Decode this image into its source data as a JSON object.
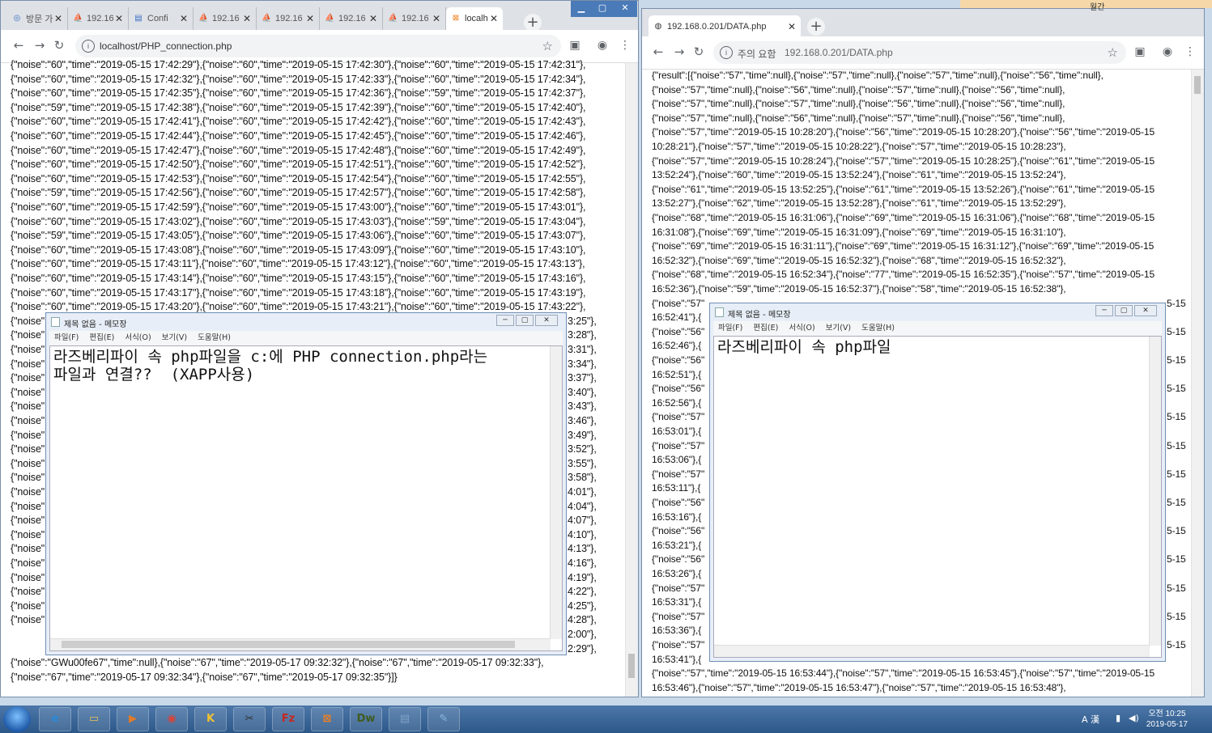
{
  "left_browser": {
    "tabs": [
      {
        "label": "방문 가",
        "icon": "compass-icon"
      },
      {
        "label": "192.16",
        "icon": "pma-icon"
      },
      {
        "label": "Confi",
        "icon": "page-icon"
      },
      {
        "label": "192.16",
        "icon": "pma-icon"
      },
      {
        "label": "192.16",
        "icon": "pma-icon"
      },
      {
        "label": "192.16",
        "icon": "pma-icon"
      },
      {
        "label": "192.16",
        "icon": "pma-icon"
      },
      {
        "label": "localh",
        "icon": "xampp-icon"
      }
    ],
    "url": "localhost/PHP_connection.php",
    "lines": [
      "{\"noise\":\"60\",\"time\":\"2019-05-15 17:42:29\"},{\"noise\":\"60\",\"time\":\"2019-05-15 17:42:30\"},{\"noise\":\"60\",\"time\":\"2019-05-15 17:42:31\"},",
      "{\"noise\":\"60\",\"time\":\"2019-05-15 17:42:32\"},{\"noise\":\"60\",\"time\":\"2019-05-15 17:42:33\"},{\"noise\":\"60\",\"time\":\"2019-05-15 17:42:34\"},",
      "{\"noise\":\"60\",\"time\":\"2019-05-15 17:42:35\"},{\"noise\":\"60\",\"time\":\"2019-05-15 17:42:36\"},{\"noise\":\"59\",\"time\":\"2019-05-15 17:42:37\"},",
      "{\"noise\":\"59\",\"time\":\"2019-05-15 17:42:38\"},{\"noise\":\"60\",\"time\":\"2019-05-15 17:42:39\"},{\"noise\":\"60\",\"time\":\"2019-05-15 17:42:40\"},",
      "{\"noise\":\"60\",\"time\":\"2019-05-15 17:42:41\"},{\"noise\":\"60\",\"time\":\"2019-05-15 17:42:42\"},{\"noise\":\"60\",\"time\":\"2019-05-15 17:42:43\"},",
      "{\"noise\":\"60\",\"time\":\"2019-05-15 17:42:44\"},{\"noise\":\"60\",\"time\":\"2019-05-15 17:42:45\"},{\"noise\":\"60\",\"time\":\"2019-05-15 17:42:46\"},",
      "{\"noise\":\"60\",\"time\":\"2019-05-15 17:42:47\"},{\"noise\":\"60\",\"time\":\"2019-05-15 17:42:48\"},{\"noise\":\"60\",\"time\":\"2019-05-15 17:42:49\"},",
      "{\"noise\":\"60\",\"time\":\"2019-05-15 17:42:50\"},{\"noise\":\"60\",\"time\":\"2019-05-15 17:42:51\"},{\"noise\":\"60\",\"time\":\"2019-05-15 17:42:52\"},",
      "{\"noise\":\"60\",\"time\":\"2019-05-15 17:42:53\"},{\"noise\":\"60\",\"time\":\"2019-05-15 17:42:54\"},{\"noise\":\"60\",\"time\":\"2019-05-15 17:42:55\"},",
      "{\"noise\":\"59\",\"time\":\"2019-05-15 17:42:56\"},{\"noise\":\"60\",\"time\":\"2019-05-15 17:42:57\"},{\"noise\":\"60\",\"time\":\"2019-05-15 17:42:58\"},",
      "{\"noise\":\"60\",\"time\":\"2019-05-15 17:42:59\"},{\"noise\":\"60\",\"time\":\"2019-05-15 17:43:00\"},{\"noise\":\"60\",\"time\":\"2019-05-15 17:43:01\"},",
      "{\"noise\":\"60\",\"time\":\"2019-05-15 17:43:02\"},{\"noise\":\"60\",\"time\":\"2019-05-15 17:43:03\"},{\"noise\":\"59\",\"time\":\"2019-05-15 17:43:04\"},",
      "{\"noise\":\"59\",\"time\":\"2019-05-15 17:43:05\"},{\"noise\":\"60\",\"time\":\"2019-05-15 17:43:06\"},{\"noise\":\"60\",\"time\":\"2019-05-15 17:43:07\"},",
      "{\"noise\":\"60\",\"time\":\"2019-05-15 17:43:08\"},{\"noise\":\"60\",\"time\":\"2019-05-15 17:43:09\"},{\"noise\":\"60\",\"time\":\"2019-05-15 17:43:10\"},",
      "{\"noise\":\"60\",\"time\":\"2019-05-15 17:43:11\"},{\"noise\":\"60\",\"time\":\"2019-05-15 17:43:12\"},{\"noise\":\"60\",\"time\":\"2019-05-15 17:43:13\"},",
      "{\"noise\":\"60\",\"time\":\"2019-05-15 17:43:14\"},{\"noise\":\"60\",\"time\":\"2019-05-15 17:43:15\"},{\"noise\":\"60\",\"time\":\"2019-05-15 17:43:16\"},",
      "{\"noise\":\"60\",\"time\":\"2019-05-15 17:43:17\"},{\"noise\":\"60\",\"time\":\"2019-05-15 17:43:18\"},{\"noise\":\"60\",\"time\":\"2019-05-15 17:43:19\"},",
      "{\"noise\":\"60\",\"time\":\"2019-05-15 17:43:20\"},{\"noise\":\"60\",\"time\":\"2019-05-15 17:43:21\"},{\"noise\":\"60\",\"time\":\"2019-05-15 17:43:22\"},"
    ],
    "partial_left": [
      "{\"noise\"",
      "{\"noise\"",
      "{\"noise\"",
      "{\"noise\"",
      "{\"noise\"",
      "{\"noise\"",
      "{\"noise\"",
      "{\"noise\"",
      "{\"noise\"",
      "{\"noise\"",
      "{\"noise\"",
      "{\"noise\"",
      "{\"noise\"",
      "{\"noise\"",
      "{\"noise\"",
      "{\"noise\"",
      "{\"noise\"",
      "{\"noise\"",
      "{\"noise\"",
      "{\"noise\"",
      "{\"noise\"",
      "{\"noise\""
    ],
    "partial_right": [
      "3:25\"},",
      "3:28\"},",
      "3:31\"},",
      "3:34\"},",
      "3:37\"},",
      "3:40\"},",
      "3:43\"},",
      "3:46\"},",
      "3:49\"},",
      "3:52\"},",
      "3:55\"},",
      "3:58\"},",
      "4:01\"},",
      "4:04\"},",
      "4:07\"},",
      "4:10\"},",
      "4:13\"},",
      "4:16\"},",
      "4:19\"},",
      "4:22\"},",
      "4:25\"},",
      "4:28\"},",
      "2:00\"},",
      "2:29\"},"
    ],
    "tail_lines": [
      "{\"noise\":\"GWu00fe67\",\"time\":null},{\"noise\":\"67\",\"time\":\"2019-05-17 09:32:32\"},{\"noise\":\"67\",\"time\":\"2019-05-17 09:32:33\"},",
      "{\"noise\":\"67\",\"time\":\"2019-05-17 09:32:34\"},{\"noise\":\"67\",\"time\":\"2019-05-17 09:32:35\"}]}"
    ]
  },
  "left_notepad": {
    "title": "제목 없음 - 메모장",
    "menu": [
      "파일(F)",
      "편집(E)",
      "서식(O)",
      "보기(V)",
      "도움말(H)"
    ],
    "text": "라즈베리파이 속 php파일을 c:에 PHP connection.php라는\n파일과 연결??  (XAPP사용)"
  },
  "right_browser": {
    "tab_label": "192.168.0.201/DATA.php",
    "security_label": "주의 요함",
    "url": "192.168.0.201/DATA.php",
    "lines": [
      "{\"result\":[{\"noise\":\"57\",\"time\":null},{\"noise\":\"57\",\"time\":null},{\"noise\":\"57\",\"time\":null},{\"noise\":\"56\",\"time\":null},",
      "{\"noise\":\"57\",\"time\":null},{\"noise\":\"56\",\"time\":null},{\"noise\":\"57\",\"time\":null},{\"noise\":\"56\",\"time\":null},",
      "{\"noise\":\"57\",\"time\":null},{\"noise\":\"57\",\"time\":null},{\"noise\":\"56\",\"time\":null},{\"noise\":\"56\",\"time\":null},",
      "{\"noise\":\"57\",\"time\":null},{\"noise\":\"56\",\"time\":null},{\"noise\":\"57\",\"time\":null},{\"noise\":\"56\",\"time\":null},",
      "{\"noise\":\"57\",\"time\":\"2019-05-15 10:28:20\"},{\"noise\":\"56\",\"time\":\"2019-05-15 10:28:20\"},{\"noise\":\"56\",\"time\":\"2019-05-15",
      "10:28:21\"},{\"noise\":\"57\",\"time\":\"2019-05-15 10:28:22\"},{\"noise\":\"57\",\"time\":\"2019-05-15 10:28:23\"},",
      "{\"noise\":\"57\",\"time\":\"2019-05-15 10:28:24\"},{\"noise\":\"57\",\"time\":\"2019-05-15 10:28:25\"},{\"noise\":\"61\",\"time\":\"2019-05-15",
      "13:52:24\"},{\"noise\":\"60\",\"time\":\"2019-05-15 13:52:24\"},{\"noise\":\"61\",\"time\":\"2019-05-15 13:52:24\"},",
      "{\"noise\":\"61\",\"time\":\"2019-05-15 13:52:25\"},{\"noise\":\"61\",\"time\":\"2019-05-15 13:52:26\"},{\"noise\":\"61\",\"time\":\"2019-05-15",
      "13:52:27\"},{\"noise\":\"62\",\"time\":\"2019-05-15 13:52:28\"},{\"noise\":\"61\",\"time\":\"2019-05-15 13:52:29\"},",
      "{\"noise\":\"68\",\"time\":\"2019-05-15 16:31:06\"},{\"noise\":\"69\",\"time\":\"2019-05-15 16:31:06\"},{\"noise\":\"68\",\"time\":\"2019-05-15",
      "16:31:08\"},{\"noise\":\"69\",\"time\":\"2019-05-15 16:31:09\"},{\"noise\":\"69\",\"time\":\"2019-05-15 16:31:10\"},",
      "{\"noise\":\"69\",\"time\":\"2019-05-15 16:31:11\"},{\"noise\":\"69\",\"time\":\"2019-05-15 16:31:12\"},{\"noise\":\"69\",\"time\":\"2019-05-15",
      "16:52:32\"},{\"noise\":\"69\",\"time\":\"2019-05-15 16:52:32\"},{\"noise\":\"68\",\"time\":\"2019-05-15 16:52:32\"},",
      "{\"noise\":\"68\",\"time\":\"2019-05-15 16:52:34\"},{\"noise\":\"77\",\"time\":\"2019-05-15 16:52:35\"},{\"noise\":\"57\",\"time\":\"2019-05-15",
      "16:52:36\"},{\"noise\":\"59\",\"time\":\"2019-05-15 16:52:37\"},{\"noise\":\"58\",\"time\":\"2019-05-15 16:52:38\"},"
    ],
    "partial_left": [
      "{\"noise\":\"57\"",
      "16:52:41\"},{",
      "{\"noise\":\"56\"",
      "16:52:46\"},{",
      "{\"noise\":\"56\"",
      "16:52:51\"},{",
      "{\"noise\":\"56\"",
      "16:52:56\"},{",
      "{\"noise\":\"57\"",
      "16:53:01\"},{",
      "{\"noise\":\"57\"",
      "16:53:06\"},{",
      "{\"noise\":\"57\"",
      "16:53:11\"},{",
      "{\"noise\":\"56\"",
      "16:53:16\"},{",
      "{\"noise\":\"56\"",
      "16:53:21\"},{",
      "{\"noise\":\"56\"",
      "16:53:26\"},{",
      "{\"noise\":\"57\"",
      "16:53:31\"},{",
      "{\"noise\":\"57\"",
      "16:53:36\"},{",
      "{\"noise\":\"57\"",
      "16:53:41\"},{"
    ],
    "partial_right": [
      "5-15",
      "5-15",
      "5-15",
      "5-15",
      "5-15",
      "5-15",
      "5-15",
      "5-15",
      "5-15",
      "5-15",
      "5-15",
      "5-15",
      "5-15"
    ],
    "tail_lines": [
      "{\"noise\":\"57\",\"time\":\"2019-05-15 16:53:44\"},{\"noise\":\"57\",\"time\":\"2019-05-15 16:53:45\"},{\"noise\":\"57\",\"time\":\"2019-05-15",
      "16:53:46\"},{\"noise\":\"57\",\"time\":\"2019-05-15 16:53:47\"},{\"noise\":\"57\",\"time\":\"2019-05-15 16:53:48\"},"
    ]
  },
  "right_notepad": {
    "title": "제목 없음 - 메모장",
    "menu": [
      "파일(F)",
      "편집(E)",
      "서식(O)",
      "보기(V)",
      "도움말(H)"
    ],
    "text": "라즈베리파이 속 php파일"
  },
  "background_window": {
    "label": "월간"
  },
  "taskbar": {
    "apps": [
      {
        "name": "ie-icon",
        "glyph": "e",
        "color": "#2a8ad8"
      },
      {
        "name": "explorer-icon",
        "glyph": "▭",
        "color": "#e8c15a"
      },
      {
        "name": "media-player-icon",
        "glyph": "▶",
        "color": "#e07b2a"
      },
      {
        "name": "chrome-icon",
        "glyph": "◉",
        "color": "#d9433a"
      },
      {
        "name": "kakaotalk-icon",
        "glyph": "K",
        "color": "#f2c230"
      },
      {
        "name": "snipping-tool-icon",
        "glyph": "✂",
        "color": "#333"
      },
      {
        "name": "filezilla-icon",
        "glyph": "Fz",
        "color": "#c7271f"
      },
      {
        "name": "xampp-icon",
        "glyph": "⊠",
        "color": "#f0801e"
      },
      {
        "name": "dreamweaver-icon",
        "glyph": "Dw",
        "color": "#3f5b1e"
      },
      {
        "name": "notepad-icon",
        "glyph": "▤",
        "color": "#7fa4c8"
      },
      {
        "name": "paint-icon",
        "glyph": "✎",
        "color": "#8bb8e0"
      }
    ],
    "ime": "A 漢",
    "time": "오전 10:25",
    "date": "2019-05-17"
  },
  "colors": {
    "chrome_frame": "#dee1e6",
    "taskbar_top": "#4c77a8",
    "window_title_blue": "#2f63a6"
  }
}
